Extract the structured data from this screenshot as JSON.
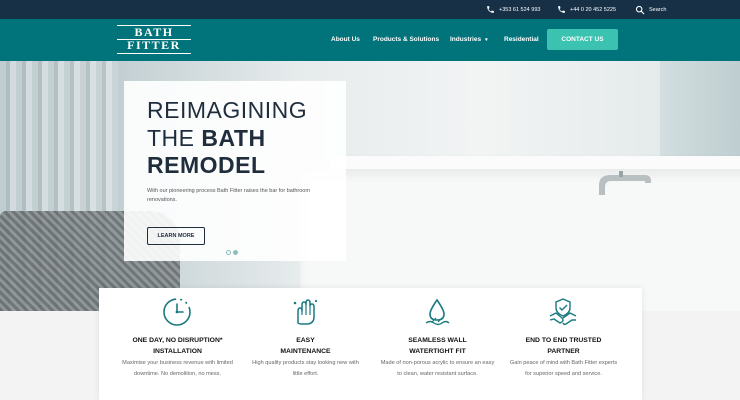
{
  "topbar": {
    "phone_1": "+353 61 524 993",
    "phone_2": "+44 0 20 452 5225",
    "search_label": "Search"
  },
  "nav": {
    "logo_line_1": "BATH",
    "logo_line_2": "FITTER",
    "links": [
      "About Us",
      "Products & Solutions",
      "Industries",
      "Residential"
    ],
    "cta_label": "CONTACT US"
  },
  "hero": {
    "title_line_1": "REIMAGINING",
    "title_line_2_light": "THE ",
    "title_line_2_bold": "BATH",
    "title_line_3": "REMODEL",
    "description": "With our pioneering process Bath Fitter raises the bar for bathroom renovations.",
    "button_label": "LEARN MORE",
    "slides_total": 2,
    "slide_active": 2
  },
  "features": [
    {
      "icon": "clock-icon",
      "title_1": "ONE DAY, NO DISRUPTION*",
      "title_2": "INSTALLATION",
      "description": "Maximise your business revenue with limited downtime. No demolition, no mess."
    },
    {
      "icon": "clean-hand-icon",
      "title_1": "EASY",
      "title_2": "MAINTENANCE",
      "description": "High quality products stay looking new with little effort."
    },
    {
      "icon": "water-drop-icon",
      "title_1": "SEAMLESS WALL",
      "title_2": "WATERTIGHT FIT",
      "description": "Made of non-porous acrylic to ensure an easy to clean, water resistant surface."
    },
    {
      "icon": "handshake-icon",
      "title_1": "END TO END TRUSTED",
      "title_2": "PARTNER",
      "description": "Gain peace of mind with Bath Fitter experts for superior speed and service."
    }
  ],
  "colors": {
    "topbar": "#173046",
    "nav": "#00747a",
    "cta": "#3cc2b0",
    "icon_teal": "#1a7a80",
    "title_dark": "#1f2d3d"
  }
}
